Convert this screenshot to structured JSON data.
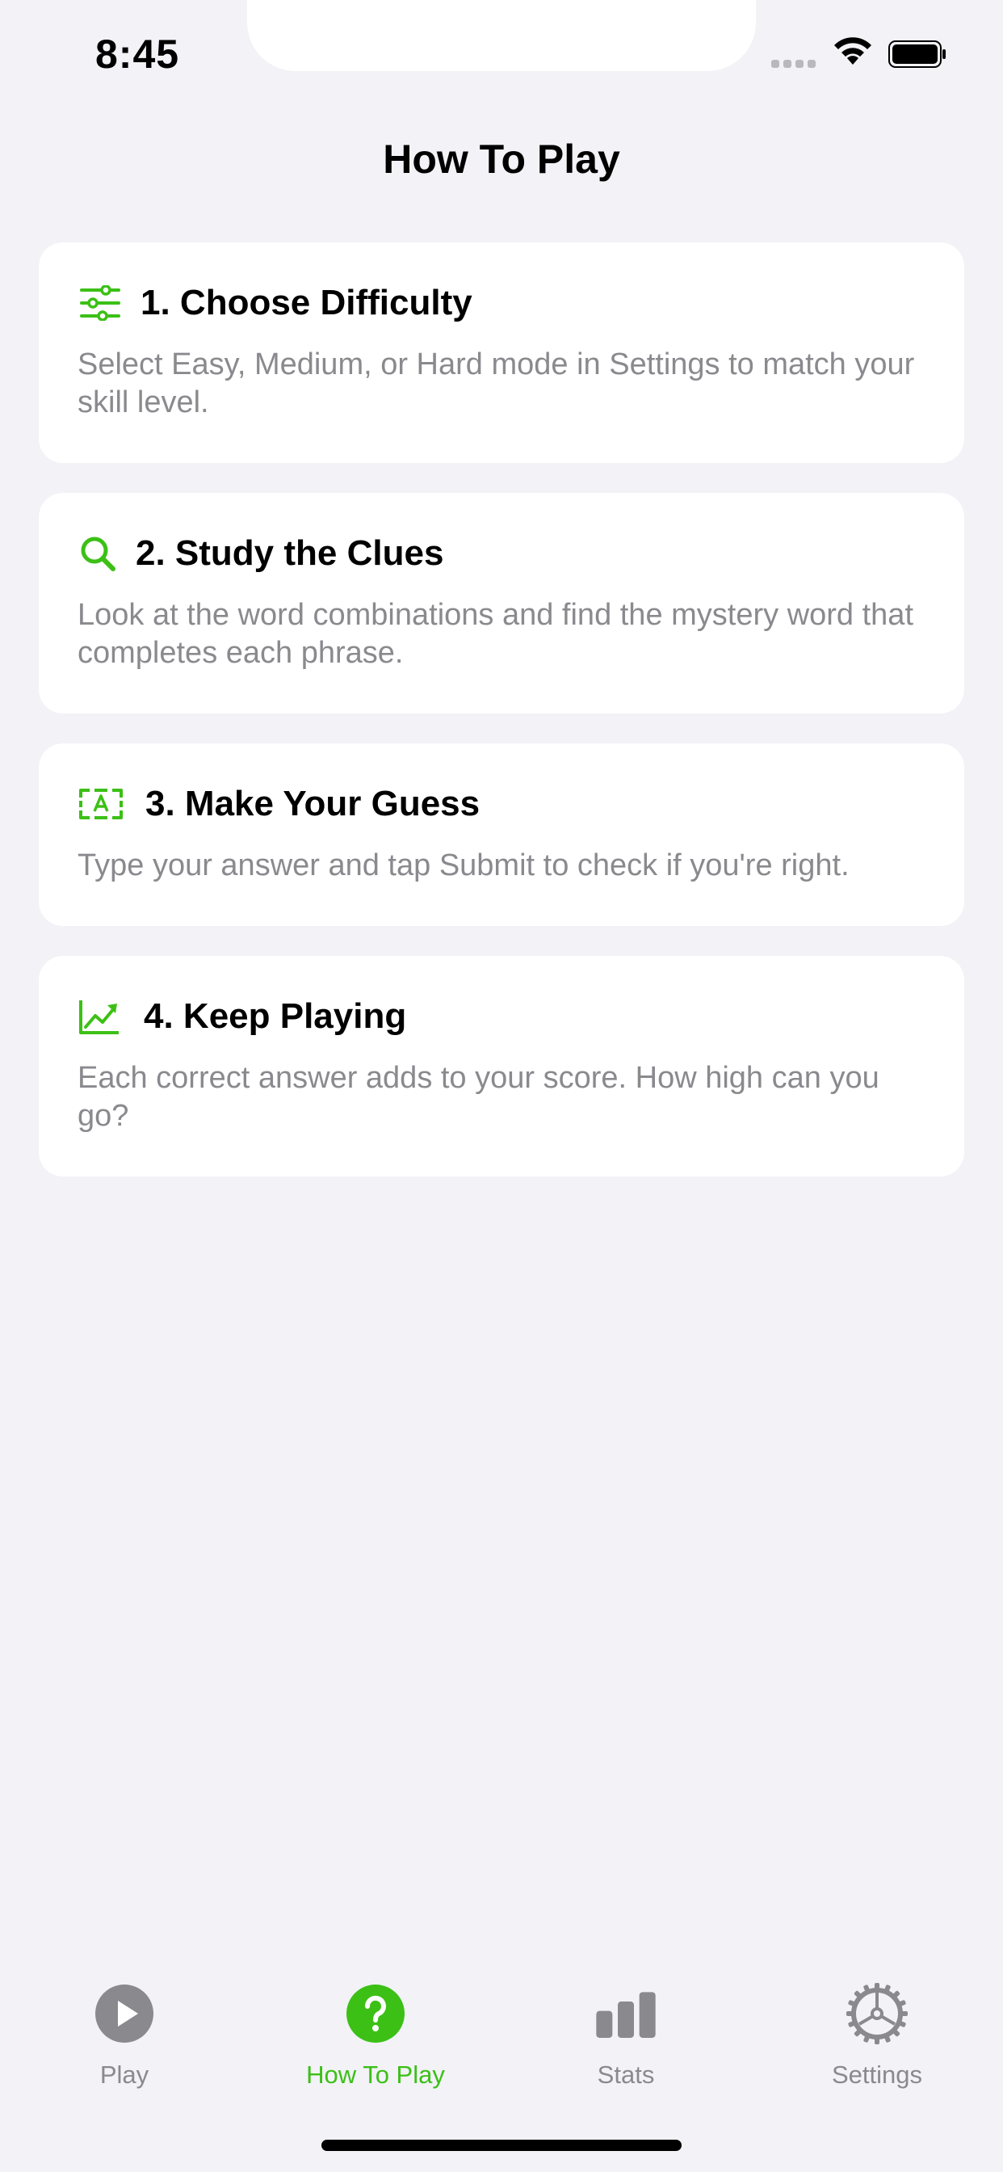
{
  "status_bar": {
    "time": "8:45"
  },
  "page": {
    "title": "How To Play"
  },
  "colors": {
    "accent": "#3CC016",
    "background": "#F2F2F7",
    "card": "#FFFFFF",
    "muted_text": "#8A8A8E"
  },
  "steps": [
    {
      "icon": "sliders-icon",
      "title": "1. Choose Difficulty",
      "description": "Select Easy, Medium, or Hard mode in Settings to match your skill level."
    },
    {
      "icon": "magnifying-glass-icon",
      "title": "2. Study the Clues",
      "description": "Look at the word combinations and find the mystery word that completes each phrase."
    },
    {
      "icon": "text-box-icon",
      "title": "3. Make Your Guess",
      "description": "Type your answer and tap Submit to check if you're right."
    },
    {
      "icon": "trending-up-chart-icon",
      "title": "4. Keep Playing",
      "description": "Each correct answer adds to your score. How high can you go?"
    }
  ],
  "tab_bar": {
    "items": [
      {
        "label": "Play",
        "icon": "play-circle-icon",
        "active": false
      },
      {
        "label": "How To Play",
        "icon": "question-circle-icon",
        "active": true
      },
      {
        "label": "Stats",
        "icon": "bar-chart-icon",
        "active": false
      },
      {
        "label": "Settings",
        "icon": "gear-icon",
        "active": false
      }
    ]
  }
}
